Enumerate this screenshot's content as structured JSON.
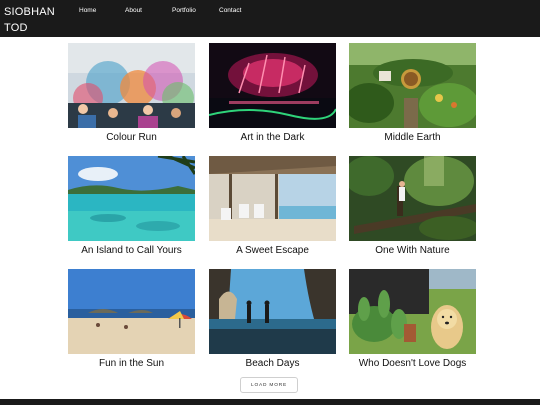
{
  "brand": {
    "line1": "SIOBHAN",
    "line2": "TOD"
  },
  "nav": [
    "Home",
    "About",
    "Portfolio",
    "Contact"
  ],
  "gallery": [
    {
      "title": "Colour Run",
      "image": "colour-run-photo"
    },
    {
      "title": "Art in the Dark",
      "image": "art-in-the-dark-photo"
    },
    {
      "title": "Middle Earth",
      "image": "middle-earth-photo"
    },
    {
      "title": "An Island to Call Yours",
      "image": "island-photo"
    },
    {
      "title": "A Sweet Escape",
      "image": "sweet-escape-photo"
    },
    {
      "title": "One With Nature",
      "image": "one-with-nature-photo"
    },
    {
      "title": "Fun in the Sun",
      "image": "fun-in-the-sun-photo"
    },
    {
      "title": "Beach Days",
      "image": "beach-days-photo"
    },
    {
      "title": "Who Doesn't Love Dogs",
      "image": "dogs-photo"
    }
  ],
  "load_more": "LOAD MORE",
  "colors": {
    "nav_bg": "#1a1a1a",
    "page_bg": "#ffffff",
    "text": "#111111"
  }
}
